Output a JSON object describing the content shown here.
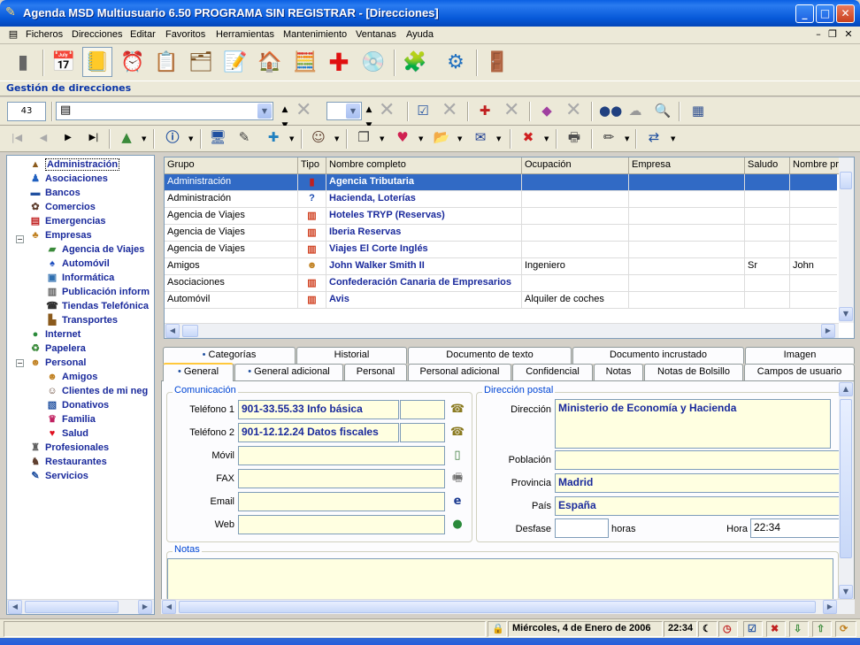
{
  "window": {
    "title": "Agenda MSD Multiusuario 6.50 PROGRAMA SIN REGISTRAR - [Direcciones]"
  },
  "menu": [
    "Ficheros",
    "Direcciones",
    "Editar",
    "Favoritos",
    "Herramientas",
    "Mantenimiento",
    "Ventanas",
    "Ayuda"
  ],
  "section_title": "Gestión de direcciones",
  "record_counter": "43",
  "tree": [
    {
      "label": "Administración",
      "icon": "building-icon"
    },
    {
      "label": "Asociaciones",
      "icon": "people-icon"
    },
    {
      "label": "Bancos",
      "icon": "bank-icon"
    },
    {
      "label": "Comercios",
      "icon": "shop-icon"
    },
    {
      "label": "Emergencias",
      "icon": "emergency-icon"
    },
    {
      "label": "Empresas",
      "icon": "company-icon"
    },
    {
      "label": "Agencia de Viajes",
      "icon": "travel-icon"
    },
    {
      "label": "Automóvil",
      "icon": "car-icon"
    },
    {
      "label": "Informática",
      "icon": "computer-icon"
    },
    {
      "label": "Publicación inform",
      "icon": "publication-icon"
    },
    {
      "label": "Tiendas Telefónica",
      "icon": "phone-icon"
    },
    {
      "label": "Transportes",
      "icon": "truck-icon"
    },
    {
      "label": "Internet",
      "icon": "globe-icon"
    },
    {
      "label": "Papelera",
      "icon": "recycle-icon"
    },
    {
      "label": "Personal",
      "icon": "person-icon"
    },
    {
      "label": "Amigos",
      "icon": "friends-icon"
    },
    {
      "label": "Clientes de mi neg",
      "icon": "clients-icon"
    },
    {
      "label": "Donativos",
      "icon": "donation-icon"
    },
    {
      "label": "Familia",
      "icon": "family-icon"
    },
    {
      "label": "Salud",
      "icon": "heart-icon"
    },
    {
      "label": "Profesionales",
      "icon": "professional-icon"
    },
    {
      "label": "Restaurantes",
      "icon": "restaurant-icon"
    },
    {
      "label": "Servicios",
      "icon": "services-icon"
    }
  ],
  "grid": {
    "headers": [
      "Grupo",
      "Tipo",
      "Nombre completo",
      "Ocupación",
      "Empresa",
      "Saludo",
      "Nombre pr"
    ],
    "rows": [
      {
        "grupo": "Administración",
        "nombre": "Agencia Tributaria",
        "ocupacion": "",
        "empresa": "",
        "saludo": "",
        "nombre_pr": ""
      },
      {
        "grupo": "Administración",
        "nombre": "Hacienda, Loterías",
        "ocupacion": "",
        "empresa": "",
        "saludo": "",
        "nombre_pr": ""
      },
      {
        "grupo": "Agencia de Viajes",
        "nombre": "Hoteles TRYP (Reservas)",
        "ocupacion": "",
        "empresa": "",
        "saludo": "",
        "nombre_pr": ""
      },
      {
        "grupo": "Agencia de Viajes",
        "nombre": "Iberia Reservas",
        "ocupacion": "",
        "empresa": "",
        "saludo": "",
        "nombre_pr": ""
      },
      {
        "grupo": "Agencia de Viajes",
        "nombre": "Viajes El Corte Inglés",
        "ocupacion": "",
        "empresa": "",
        "saludo": "",
        "nombre_pr": ""
      },
      {
        "grupo": "Amigos",
        "nombre": "John Walker Smith II",
        "ocupacion": "Ingeniero",
        "empresa": "",
        "saludo": "Sr",
        "nombre_pr": "John"
      },
      {
        "grupo": "Asociaciones",
        "nombre": "Confederación Canaria de Empresarios",
        "ocupacion": "",
        "empresa": "",
        "saludo": "",
        "nombre_pr": ""
      },
      {
        "grupo": "Automóvil",
        "nombre": "Avis",
        "ocupacion": "Alquiler de coches",
        "empresa": "",
        "saludo": "",
        "nombre_pr": ""
      }
    ]
  },
  "tabs_top": [
    "Categorías",
    "Historial",
    "Documento de texto",
    "Documento incrustado",
    "Imagen"
  ],
  "tabs_bottom": [
    "General",
    "General adicional",
    "Personal",
    "Personal adicional",
    "Confidencial",
    "Notas",
    "Notas de Bolsillo",
    "Campos de usuario"
  ],
  "comunicacion": {
    "title": "Comunicación",
    "telefono1_label": "Teléfono 1",
    "telefono1": "901-33.55.33 Info básica",
    "telefono2_label": "Teléfono 2",
    "telefono2": "901-12.12.24 Datos fiscales",
    "movil_label": "Móvil",
    "movil": "",
    "fax_label": "FAX",
    "fax": "",
    "email_label": "Email",
    "email": "",
    "web_label": "Web",
    "web": ""
  },
  "direccion": {
    "title": "Dirección postal",
    "direccion_label": "Dirección",
    "direccion": "Ministerio de Economía y Hacienda",
    "poblacion_label": "Población",
    "poblacion": "",
    "provincia_label": "Provincia",
    "provincia": "Madrid",
    "pais_label": "País",
    "pais": "España",
    "desfase_label": "Desfase",
    "desfase": "",
    "horas_label": "horas",
    "hora_label": "Hora",
    "hora": "22:34"
  },
  "notas": {
    "title": "Notas",
    "value": ""
  },
  "status": {
    "date": "Miércoles, 4 de Enero de 2006",
    "time": "22:34"
  }
}
